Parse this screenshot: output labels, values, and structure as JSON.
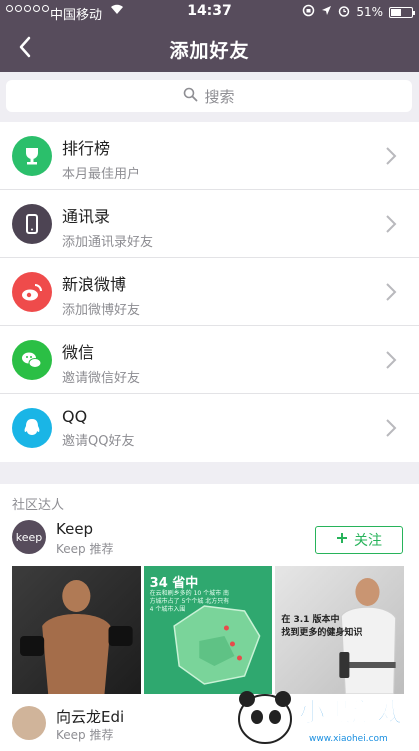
{
  "status": {
    "carrier": "中国移动",
    "time": "14:37",
    "battery": "51%",
    "battery_level": 0.51
  },
  "nav": {
    "title": "添加好友"
  },
  "search": {
    "placeholder": "搜索"
  },
  "list": [
    {
      "title": "排行榜",
      "subtitle": "本月最佳用户",
      "icon": "trophy-icon",
      "color": "#2bbf6b"
    },
    {
      "title": "通讯录",
      "subtitle": "添加通讯录好友",
      "icon": "phone-icon",
      "color": "#4d4453"
    },
    {
      "title": "新浪微博",
      "subtitle": "添加微博好友",
      "icon": "weibo-icon",
      "color": "#ef4b4b"
    },
    {
      "title": "微信",
      "subtitle": "邀请微信好友",
      "icon": "wechat-icon",
      "color": "#2bbf45"
    },
    {
      "title": "QQ",
      "subtitle": "邀请QQ好友",
      "icon": "qq-icon",
      "color": "#1ab5e6"
    }
  ],
  "community": {
    "section_title": "社区达人",
    "user1": {
      "name": "Keep",
      "subtitle": "Keep 推荐",
      "avatar_text": "keep"
    },
    "follow_label": "关注",
    "map_title": "34 省中",
    "map_sub": "在云和刷乡多的 10 个城市 南方城市占了 5个个城 北方只有 4 个城市入围",
    "photo3_line1": "在 3.1 版本中",
    "photo3_line2": "找到更多的健身知识",
    "user2": {
      "name": "向云龙Edi",
      "subtitle": "Keep 推荐"
    }
  },
  "watermark": {
    "text": "小黑游戏",
    "url": "www.xiaohei.com"
  },
  "colors": {
    "header": "#574c5c",
    "accent": "#27b35a"
  }
}
